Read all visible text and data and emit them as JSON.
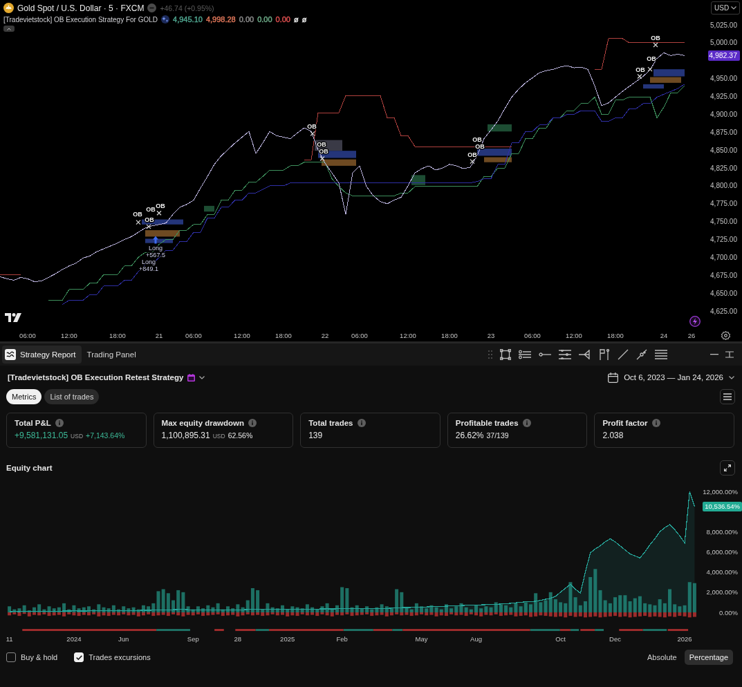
{
  "chart_header": {
    "symbol": "Gold Spot / U.S. Dollar · 5 · FXCM",
    "change": "+46.74 (+0.95%)",
    "indicator": {
      "title": "[Tradevietstock] OB Execution Strategy For GOLD",
      "values": [
        {
          "text": "4,945.10",
          "color": "#4fa58f"
        },
        {
          "text": "4,998.28",
          "color": "#e0775a"
        },
        {
          "text": "0.00",
          "color": "#8f8f8f"
        },
        {
          "text": "0.00",
          "color": "#6fae8a"
        },
        {
          "text": "0.00",
          "color": "#e04f4f"
        },
        {
          "text": "ø"
        },
        {
          "text": "ø"
        }
      ]
    }
  },
  "currency": "USD",
  "price_chart": {
    "last_price_label": "4,982.37",
    "chart_data": {
      "type": "line",
      "categories": [
        null,
        null,
        null,
        null,
        "06:00",
        null,
        null,
        null,
        null,
        null,
        "12:00",
        null,
        null,
        null,
        null,
        null,
        null,
        "18:00",
        null,
        null,
        null,
        null,
        null,
        "21",
        null,
        null,
        null,
        null,
        "06:00",
        null,
        null,
        null,
        null,
        null,
        null,
        "12:00",
        null,
        null,
        null,
        null,
        null,
        "18:00",
        null,
        null,
        null,
        null,
        null,
        "22",
        null,
        null,
        null,
        null,
        "06:00",
        null,
        null,
        null,
        null,
        null,
        null,
        "12:00",
        null,
        null,
        null,
        null,
        null,
        "18:00",
        null,
        null,
        null,
        null,
        null,
        "23",
        null,
        null,
        null,
        null,
        null,
        "06:00",
        null,
        null,
        null,
        null,
        null,
        "12:00",
        null,
        null,
        null,
        null,
        null,
        "18:00",
        null,
        null,
        null,
        null,
        null,
        null,
        "24",
        null,
        null,
        null,
        "26",
        null,
        null
      ],
      "series": [
        {
          "color": "#3d8f5c",
          "values": [
            null,
            null,
            null,
            null,
            null,
            null,
            null,
            4640,
            4640,
            4640,
            4655,
            4655,
            4655,
            4664,
            4664,
            4676,
            4676,
            4676,
            4688,
            4688,
            4700,
            4707,
            4707,
            4718,
            4725,
            4725,
            4738,
            4738,
            4746,
            4746,
            4760,
            4760,
            4780,
            4780,
            4794,
            4794,
            4805,
            4805,
            4813,
            4822,
            4822,
            4822,
            4828,
            4828,
            4833,
            4833,
            4833,
            4833,
            4810,
            4799,
            4790,
            4786,
            4786,
            4786,
            4786,
            4786,
            4786,
            4786,
            4790,
            4790,
            4799,
            4799,
            4799,
            4799,
            4799,
            4799,
            4799,
            4799,
            4799,
            4799,
            4813,
            4813,
            4825,
            4825,
            4845,
            4845,
            4866,
            4866,
            4881,
            4881,
            4895,
            4895,
            4905,
            4905,
            4915,
            4915,
            4924,
            4900,
            4900,
            4920,
            4920,
            4924,
            4924,
            4924,
            4924,
            4895,
            4910,
            4930,
            4930,
            4940,
            null,
            null,
            null
          ]
        },
        {
          "color": "#2f2fa6",
          "values": [
            null,
            null,
            null,
            null,
            null,
            null,
            null,
            null,
            null,
            4634,
            4640,
            4640,
            4640,
            4648,
            4648,
            4660,
            4660,
            4660,
            4668,
            4668,
            4680,
            4690,
            4690,
            4700,
            4710,
            4710,
            4722,
            4722,
            4735,
            4735,
            4755,
            4755,
            4770,
            4770,
            4780,
            4780,
            4790,
            4790,
            4795,
            4800,
            4800,
            4800,
            4804,
            4804,
            4804,
            4804,
            4804,
            4804,
            4804,
            4804,
            4804,
            4804,
            4804,
            4804,
            4804,
            4804,
            4804,
            4804,
            4804,
            4804,
            4804,
            4804,
            4804,
            4804,
            4804,
            4804,
            4804,
            4804,
            4804,
            4806,
            4810,
            4810,
            4830,
            4830,
            4860,
            4860,
            4876,
            4876,
            4885,
            4885,
            4895,
            4895,
            4900,
            4900,
            4905,
            4905,
            4905,
            4890,
            4890,
            4895,
            4895,
            4908,
            4908,
            4915,
            4915,
            4924,
            4928,
            4932,
            4936,
            4942,
            null,
            null,
            null
          ]
        },
        {
          "color": "#b0413e",
          "values": [
            4676,
            4676,
            4676,
            4676,
            null,
            null,
            null,
            null,
            null,
            null,
            null,
            null,
            null,
            null,
            null,
            null,
            null,
            null,
            null,
            null,
            null,
            null,
            null,
            null,
            null,
            null,
            null,
            null,
            null,
            null,
            null,
            null,
            null,
            null,
            null,
            null,
            null,
            null,
            null,
            null,
            null,
            null,
            null,
            null,
            4836,
            4836,
            4902,
            4902,
            4902,
            4902,
            4926,
            4926,
            4926,
            4926,
            4926,
            4926,
            4895,
            4895,
            4870,
            4870,
            4855,
            4855,
            4855,
            4855,
            4855,
            4855,
            4855,
            4855,
            4855,
            4855,
            4855,
            4855,
            4855,
            4855,
            4855,
            null,
            null,
            null,
            null,
            null,
            null,
            null,
            null,
            null,
            null,
            null,
            4963,
            4963,
            5006,
            5006,
            5006,
            5000,
            5000,
            5000,
            5000,
            5000,
            5000,
            5000,
            5000,
            5000,
            null,
            null,
            null
          ]
        },
        {
          "color": "#b9b2dc",
          "values": [
            4673,
            4670,
            4668,
            4672,
            4670,
            4666,
            4667,
            4672,
            4677,
            4683,
            4688,
            4692,
            4699,
            4702,
            4708,
            4712,
            4716,
            4720,
            4725,
            4729,
            4735,
            4741,
            4744,
            4746,
            4748,
            4760,
            4770,
            4774,
            4780,
            4797,
            4813,
            4830,
            4842,
            4851,
            4860,
            4868,
            4876,
            4845,
            4860,
            4876,
            4870,
            4868,
            4866,
            4874,
            4881,
            4876,
            4850,
            4832,
            4818,
            4804,
            4760,
            4818,
            4828,
            4799,
            4786,
            4778,
            4775,
            4780,
            4784,
            4800,
            4818,
            4824,
            4828,
            4822,
            4825,
            4830,
            4828,
            4824,
            4826,
            4842,
            4866,
            4878,
            4891,
            4908,
            4924,
            4935,
            4944,
            4951,
            4958,
            4961,
            4963,
            4966,
            4968,
            4965,
            4966,
            4963,
            4940,
            4912,
            4916,
            4924,
            4932,
            4939,
            4946,
            4953,
            4962,
            4978,
            4986,
            4982,
            4984,
            4982,
            null,
            null,
            null
          ]
        }
      ],
      "ylim": [
        4625,
        5025
      ],
      "yticks": [
        {
          "value": 4625,
          "label": "4,625.00"
        },
        {
          "value": 4650,
          "label": "4,650.00"
        },
        {
          "value": 4675,
          "label": "4,675.00"
        },
        {
          "value": 4700,
          "label": "4,700.00"
        },
        {
          "value": 4725,
          "label": "4,725.00"
        },
        {
          "value": 4750,
          "label": "4,750.00"
        },
        {
          "value": 4775,
          "label": "4,775.00"
        },
        {
          "value": 4800,
          "label": "4,800.00"
        },
        {
          "value": 4825,
          "label": "4,825.00"
        },
        {
          "value": 4850,
          "label": "4,850.00"
        },
        {
          "value": 4875,
          "label": "4,875.00"
        },
        {
          "value": 4900,
          "label": "4,900.00"
        },
        {
          "value": 4925,
          "label": "4,925.00"
        },
        {
          "value": 4950,
          "label": "4,950.00"
        },
        {
          "value": 5000,
          "label": "5,000.00"
        },
        {
          "value": 5025,
          "label": "5,025.00"
        }
      ],
      "annotations": [
        "OB",
        "OB",
        "OB",
        "OB",
        "OB",
        "OB",
        "OB",
        "OB",
        "OB",
        "OB",
        "OB",
        "OB",
        "OB",
        "Long",
        "+567.5",
        "Long",
        "+849.1"
      ]
    }
  },
  "panel_tabs": [
    {
      "label": "Strategy Report",
      "selected": true
    },
    {
      "label": "Trading Panel",
      "selected": false
    }
  ],
  "strategy": {
    "title": "[Tradevietstock] OB Execution Retest Strategy",
    "date_range": "Oct 6, 2023 — Jan 24, 2026"
  },
  "report_tabs": [
    {
      "label": "Metrics",
      "selected": true
    },
    {
      "label": "List of trades",
      "selected": false
    }
  ],
  "metrics": [
    {
      "title": "Total P&L",
      "value": "+9,581,131.05",
      "unit": "USD",
      "secondary": "+7,143.64%",
      "positive": true
    },
    {
      "title": "Max equity drawdown",
      "value": "1,100,895.31",
      "unit": "USD",
      "secondary": "62.56%",
      "positive": false
    },
    {
      "title": "Total trades",
      "value": "139",
      "positive": false
    },
    {
      "title": "Profitable trades",
      "value": "26.62%",
      "secondary": "37/139",
      "positive": false
    },
    {
      "title": "Profit factor",
      "value": "2.038",
      "positive": false
    }
  ],
  "equity_chart": {
    "title": "Equity chart",
    "last_value_label": "10,536.54%",
    "chart_data": {
      "type": "area",
      "categories": [
        "11",
        null,
        null,
        null,
        null,
        null,
        null,
        null,
        null,
        null,
        null,
        null,
        null,
        "2024",
        null,
        null,
        null,
        null,
        null,
        null,
        null,
        null,
        null,
        "Jun",
        null,
        null,
        null,
        null,
        null,
        null,
        null,
        null,
        null,
        null,
        null,
        null,
        null,
        "Sep",
        null,
        null,
        null,
        null,
        null,
        null,
        null,
        null,
        "28",
        null,
        null,
        null,
        null,
        null,
        null,
        null,
        null,
        null,
        "2025",
        null,
        null,
        null,
        null,
        null,
        null,
        null,
        null,
        null,
        null,
        "Feb",
        null,
        null,
        null,
        null,
        null,
        null,
        null,
        null,
        null,
        null,
        null,
        null,
        null,
        null,
        null,
        "May",
        null,
        null,
        null,
        null,
        null,
        null,
        null,
        null,
        null,
        null,
        "Aug",
        null,
        null,
        null,
        null,
        null,
        null,
        null,
        null,
        null,
        null,
        null,
        null,
        null,
        null,
        null,
        null,
        "Oct",
        null,
        null,
        null,
        null,
        null,
        null,
        null,
        null,
        null,
        null,
        "Dec",
        null,
        null,
        null,
        null,
        null,
        null,
        null,
        null,
        null,
        null,
        null,
        null,
        null,
        "2026",
        null,
        null
      ],
      "series": [
        {
          "color": "#26a69a",
          "values": [
            60,
            80,
            70,
            100,
            90,
            110,
            100,
            120,
            110,
            130,
            120,
            140,
            130,
            150,
            140,
            130,
            150,
            160,
            150,
            170,
            160,
            180,
            170,
            190,
            180,
            200,
            190,
            210,
            200,
            220,
            240,
            260,
            250,
            270,
            280,
            290,
            270,
            260,
            250,
            240,
            230,
            240,
            250,
            240,
            230,
            240,
            250,
            260,
            280,
            300,
            310,
            300,
            290,
            300,
            310,
            320,
            310,
            300,
            310,
            320,
            330,
            320,
            330,
            340,
            350,
            340,
            350,
            380,
            400,
            390,
            380,
            370,
            380,
            390,
            380,
            390,
            400,
            420,
            450,
            470,
            480,
            490,
            500,
            520,
            540,
            560,
            580,
            600,
            620,
            640,
            660,
            680,
            700,
            720,
            740,
            750,
            760,
            780,
            800,
            830,
            860,
            900,
            950,
            1000,
            1050,
            1080,
            1100,
            1200,
            1300,
            1400,
            1600,
            2000,
            2400,
            2800,
            2300,
            1900,
            4000,
            5900,
            6300,
            6600,
            7000,
            7300,
            7000,
            6600,
            6200,
            5800,
            5600,
            5400,
            6000,
            6700,
            7300,
            8000,
            8400,
            8700,
            8200,
            7600,
            6900,
            12000,
            10500
          ]
        }
      ],
      "ylim": [
        0,
        12000
      ],
      "yticks": [
        {
          "value": 0,
          "label": "0.00%"
        },
        {
          "value": 2000,
          "label": "2,000.00%"
        },
        {
          "value": 4000,
          "label": "4,000.00%"
        },
        {
          "value": 6000,
          "label": "6,000.00%"
        },
        {
          "value": 8000,
          "label": "8,000.00%"
        },
        {
          "value": 12000,
          "label": "12,000.00%"
        }
      ]
    }
  },
  "options": [
    {
      "label": "Buy & hold",
      "checked": false
    },
    {
      "label": "Trades excursions",
      "checked": true
    }
  ],
  "scale_modes": [
    {
      "label": "Absolute",
      "selected": false
    },
    {
      "label": "Percentage",
      "selected": true
    }
  ]
}
